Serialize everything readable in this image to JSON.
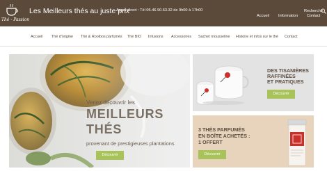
{
  "header": {
    "logo_text": "Thé - Passion",
    "tagline": "Les Meilleurs thés au juste prix",
    "phone": "Appel direct : Tél 05.46.90.63.32 de 9h00 à 17h00",
    "links": [
      "Accueil",
      "Information",
      "Contact"
    ],
    "search_label": "Recherche"
  },
  "nav": {
    "items": [
      "Accueil",
      "Thé d'origine",
      "Thé & Rooibos parfumés",
      "Thé BIO",
      "Infusions",
      "Accessoires",
      "Sachet mousseline",
      "Histoire et infos sur le thé",
      "Contact"
    ]
  },
  "hero": {
    "intro": "Venez découvrir les",
    "title_line1": "MEILLEURS",
    "title_line2": "THÉS",
    "subtitle": "provenant de prestigieuses plantations",
    "button": "Découvrir"
  },
  "promo1": {
    "line1": "DES TISANIÈRES",
    "line2": "RAFFINÉES",
    "line3": "ET PRATIQUES",
    "button": "Découvrir"
  },
  "promo2": {
    "line1": "3 THÉS PARFUMÉS",
    "line2": "EN BOÎTE ACHETÉS :",
    "line3": "1 OFFERT",
    "button": "Découvrir"
  },
  "colors": {
    "header_bg": "#5b4a3a",
    "accent_green": "#a8c35a",
    "promo_beige": "#e8d3bc",
    "tin_red": "#c8302a"
  }
}
